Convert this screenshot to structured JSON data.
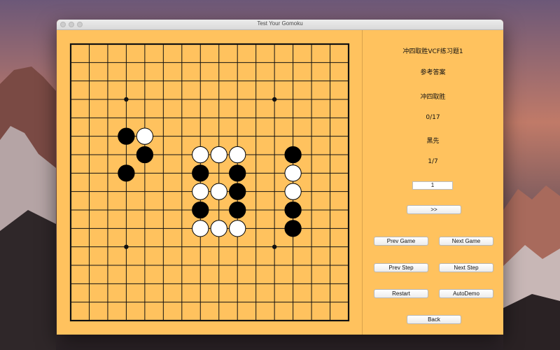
{
  "window": {
    "title": "Test Your Gomoku"
  },
  "colors": {
    "board": "#ffc25e",
    "black_stone": "#000000",
    "white_stone": "#ffffff"
  },
  "board": {
    "size": 15,
    "star_points": [
      [
        3,
        3
      ],
      [
        11,
        3
      ],
      [
        3,
        11
      ],
      [
        11,
        11
      ]
    ],
    "stones": [
      {
        "col": 3,
        "row": 5,
        "color": "black"
      },
      {
        "col": 4,
        "row": 5,
        "color": "white"
      },
      {
        "col": 4,
        "row": 6,
        "color": "black"
      },
      {
        "col": 3,
        "row": 7,
        "color": "black"
      },
      {
        "col": 7,
        "row": 6,
        "color": "white"
      },
      {
        "col": 8,
        "row": 6,
        "color": "white"
      },
      {
        "col": 9,
        "row": 6,
        "color": "white"
      },
      {
        "col": 7,
        "row": 7,
        "color": "black"
      },
      {
        "col": 9,
        "row": 7,
        "color": "black"
      },
      {
        "col": 7,
        "row": 8,
        "color": "white"
      },
      {
        "col": 8,
        "row": 8,
        "color": "white"
      },
      {
        "col": 9,
        "row": 8,
        "color": "black"
      },
      {
        "col": 7,
        "row": 9,
        "color": "black"
      },
      {
        "col": 9,
        "row": 9,
        "color": "black"
      },
      {
        "col": 7,
        "row": 10,
        "color": "white"
      },
      {
        "col": 8,
        "row": 10,
        "color": "white"
      },
      {
        "col": 9,
        "row": 10,
        "color": "white"
      },
      {
        "col": 12,
        "row": 6,
        "color": "black"
      },
      {
        "col": 12,
        "row": 7,
        "color": "white"
      },
      {
        "col": 12,
        "row": 8,
        "color": "white"
      },
      {
        "col": 12,
        "row": 9,
        "color": "black"
      },
      {
        "col": 12,
        "row": 10,
        "color": "black"
      }
    ]
  },
  "panel": {
    "puzzle_title": "冲四取胜VCF练习题1",
    "reference_answer": "参考答案",
    "goal": "冲四取胜",
    "move_progress": "0/17",
    "first_player": "黑先",
    "puzzle_progress": "1/7",
    "jump_value": "1",
    "jump_button": ">>",
    "prev_game": "Prev Game",
    "next_game": "Next Game",
    "prev_step": "Prev Step",
    "next_step": "Next Step",
    "restart": "Restart",
    "auto_demo": "AutoDemo",
    "back": "Back"
  }
}
